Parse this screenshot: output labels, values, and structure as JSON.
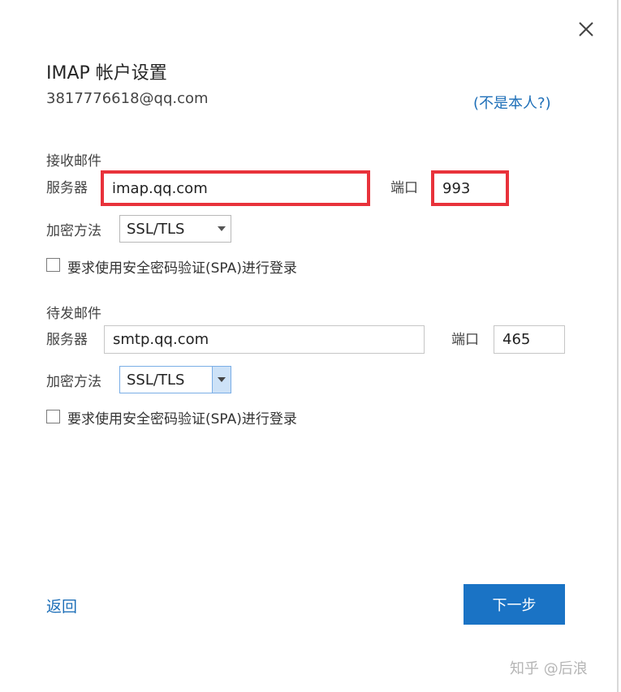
{
  "dialog": {
    "title": "IMAP 帐户设置",
    "email": "3817776618@qq.com",
    "not_you_link": "(不是本人?)",
    "close_icon": "close-icon"
  },
  "incoming": {
    "section_title": "接收邮件",
    "server_label": "服务器",
    "server_value": "imap.qq.com",
    "port_label": "端口",
    "port_value": "993",
    "encryption_label": "加密方法",
    "encryption_value": "SSL/TLS",
    "spa_label": "要求使用安全密码验证(SPA)进行登录",
    "spa_checked": false,
    "highlight_color": "#e8323b"
  },
  "outgoing": {
    "section_title": "待发邮件",
    "server_label": "服务器",
    "server_value": "smtp.qq.com",
    "port_label": "端口",
    "port_value": "465",
    "encryption_label": "加密方法",
    "encryption_value": "SSL/TLS",
    "spa_label": "要求使用安全密码验证(SPA)进行登录",
    "spa_checked": false
  },
  "footer": {
    "back_label": "返回",
    "next_label": "下一步"
  },
  "watermark": "知乎 @后浪",
  "colors": {
    "accent": "#1a73c5",
    "link": "#1e6fb8"
  }
}
